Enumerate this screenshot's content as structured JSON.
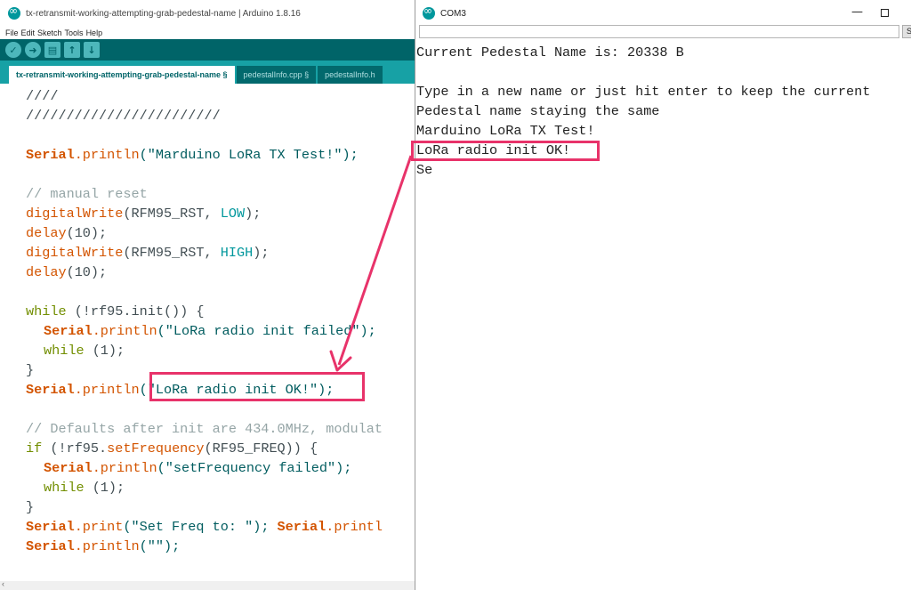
{
  "ide": {
    "title": "tx-retransmit-working-attempting-grab-pedestal-name | Arduino 1.8.16",
    "menu": [
      "File",
      "Edit",
      "Sketch",
      "Tools",
      "Help"
    ],
    "toolbar": {
      "verify_icon": "checkmark-icon",
      "upload_icon": "arrow-right-icon",
      "new_icon": "new-file-icon",
      "open_icon": "arrow-up-icon",
      "save_icon": "arrow-down-icon"
    },
    "tabs": [
      {
        "label": "tx-retransmit-working-attempting-grab-pedestal-name §",
        "active": true
      },
      {
        "label": "pedestalInfo.cpp §",
        "active": false
      },
      {
        "label": "pedestalInfo.h",
        "active": false
      }
    ],
    "code": {
      "l1": "////",
      "l2": "////////////////////////",
      "l4_obj": "Serial",
      "l4_fn": ".println",
      "l4_str": "(\"Marduino LoRa TX Test!\");",
      "l6": "// manual reset",
      "l7_fn": "digitalWrite",
      "l7_args": "(RFM95_RST, ",
      "l7_const": "LOW",
      "l7_end": ");",
      "l8_fn": "delay",
      "l8_args": "(10);",
      "l9_fn": "digitalWrite",
      "l9_args": "(RFM95_RST, ",
      "l9_const": "HIGH",
      "l9_end": ");",
      "l10_fn": "delay",
      "l10_args": "(10);",
      "l12_kw": "while",
      "l12_rest": " (!rf95.init()) {",
      "l13_obj": "Serial",
      "l13_fn": ".println",
      "l13_str": "(\"LoRa radio init failed\");",
      "l14_kw": "while",
      "l14_rest": " (1);",
      "l15": "}",
      "l16_obj": "Serial",
      "l16_fn": ".println",
      "l16_str": "(\"LoRa radio init OK!\");",
      "l18": "// Defaults after init are 434.0MHz, modulat",
      "l19_kw": "if",
      "l19_a": " (!rf95.",
      "l19_fn": "setFrequency",
      "l19_b": "(RF95_FREQ)) {",
      "l20_obj": "Serial",
      "l20_fn": ".println",
      "l20_str": "(\"setFrequency failed\");",
      "l21_kw": "while",
      "l21_rest": " (1);",
      "l22": "}",
      "l23_obj": "Serial",
      "l23_fn": ".print",
      "l23_str": "(\"Set Freq to: \"); ",
      "l23_obj2": "Serial",
      "l23_fn2": ".printl",
      "l24_obj": "Serial",
      "l24_fn": ".println",
      "l24_str": "(\"\");"
    }
  },
  "serial_monitor": {
    "title": "COM3",
    "input_value": "",
    "send_label": "S",
    "output": [
      "Current Pedestal Name is: 20338 B",
      "",
      "Type in a new name or just hit enter to keep the current",
      "Pedestal name staying the same",
      "Marduino LoRa TX Test!",
      "LoRa radio init OK!",
      "Se"
    ]
  },
  "colors": {
    "annotation": "#e8336a",
    "toolbar": "#006468",
    "tabbar": "#17a1a5"
  }
}
